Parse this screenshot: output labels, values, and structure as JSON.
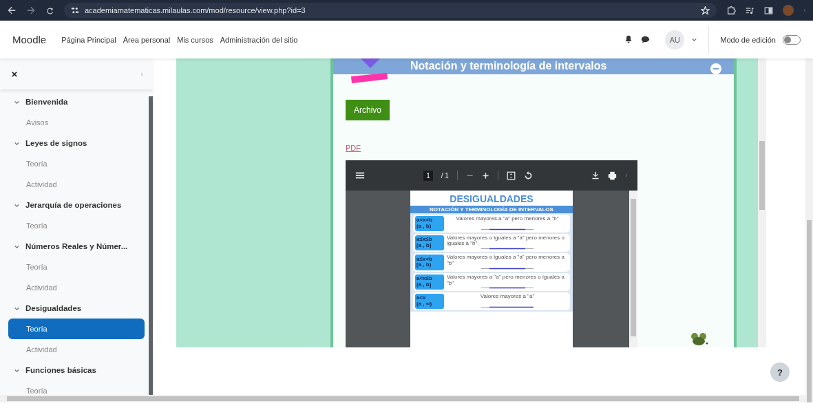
{
  "browser": {
    "url": "academiamatematicas.milaulas.com/mod/resource/view.php?id=3"
  },
  "navbar": {
    "brand": "Moodle",
    "links": [
      "Página Principal",
      "Área personal",
      "Mis cursos",
      "Administración del sitio"
    ],
    "avatar": "AU",
    "edit_mode": {
      "label": "Modo de edición",
      "on": false
    }
  },
  "sidebar": {
    "sections": [
      {
        "title": "Bienvenida",
        "expanded": true,
        "children": [
          {
            "label": "Avisos",
            "selected": false
          }
        ]
      },
      {
        "title": "Leyes de signos",
        "expanded": true,
        "children": [
          {
            "label": "Teoría",
            "selected": false
          },
          {
            "label": "Actividad",
            "selected": false
          }
        ]
      },
      {
        "title": "Jerarquía de operaciones",
        "expanded": true,
        "children": [
          {
            "label": "Teoría",
            "selected": false
          }
        ]
      },
      {
        "title": "Números Reales y Númer...",
        "expanded": true,
        "children": [
          {
            "label": "Teoría",
            "selected": false
          },
          {
            "label": "Actividad",
            "selected": false
          }
        ]
      },
      {
        "title": "Desigualdades",
        "expanded": true,
        "children": [
          {
            "label": "Teoría",
            "selected": true
          },
          {
            "label": "Actividad",
            "selected": false
          }
        ]
      },
      {
        "title": "Funciones básicas",
        "expanded": true,
        "children": [
          {
            "label": "Teoría",
            "selected": false
          }
        ]
      }
    ]
  },
  "content": {
    "banner_title": "Notación y terminología de intervalos",
    "file_button": "Archivo",
    "pdf_link": "PDF",
    "pdf_viewer": {
      "page": "1",
      "page_count": "/ 1",
      "document": {
        "title": "DESIGUALDADES",
        "subtitle": "NOTACIÓN Y TERMINOLOGÍA DE INTERVALOS",
        "rows": [
          {
            "kind": "bounded",
            "inequality": "a<x<b",
            "interval": "(a , b)",
            "description": "Valores mayores a \"a\" pero menores a \"b\""
          },
          {
            "kind": "bounded",
            "inequality": "a≤x≤b",
            "interval": "[a , b]",
            "description": "Valores mayores o iguales a \"a\" pero menores o iguales a \"b\""
          },
          {
            "kind": "bounded",
            "inequality": "a≤x<b",
            "interval": "[a , b)",
            "description": "Valores mayores o iguales a \"a\" pero menores a \"b\""
          },
          {
            "kind": "bounded",
            "inequality": "a<x≤b",
            "interval": "(a , b]",
            "description": "Valores mayores a \"a\" pero menores o iguales a \"b\""
          },
          {
            "kind": "unbounded",
            "inequality": "a<x",
            "interval": "(a , ∞)",
            "description": "Valores mayores a \"a\""
          }
        ]
      }
    }
  },
  "help_button": "?"
}
